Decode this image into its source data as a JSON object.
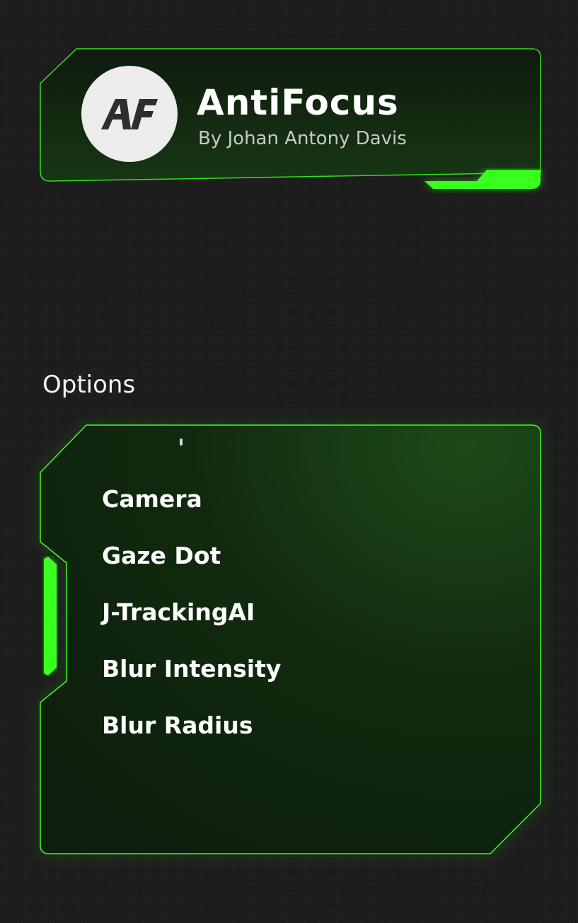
{
  "app": {
    "title": "AntiFocus",
    "author": "By Johan Antony Davis",
    "logo_text": "AF"
  },
  "options": {
    "title": "Options",
    "items": [
      {
        "label": "Camera"
      },
      {
        "label": "Gaze Dot"
      },
      {
        "label": "J-TrackingAI"
      },
      {
        "label": "Blur Intensity"
      },
      {
        "label": "Blur Radius"
      }
    ]
  },
  "theme": {
    "accent": "#39ff1f",
    "background": "#1b1b1b",
    "panel_tint": "#0f2f0d",
    "logo_bg": "#ececec",
    "logo_fg": "#2e2e2e"
  },
  "icons": {
    "logo": "af-logo-icon",
    "scroll": "scroll-indicator"
  }
}
